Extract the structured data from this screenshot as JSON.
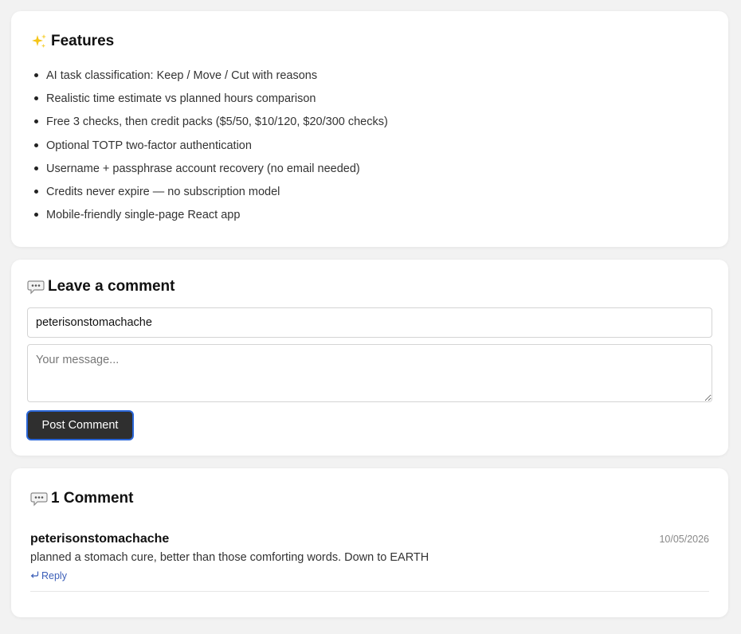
{
  "features": {
    "title": "Features",
    "icon": "sparkles-icon",
    "items": [
      "AI task classification: Keep / Move / Cut with reasons",
      "Realistic time estimate vs planned hours comparison",
      "Free 3 checks, then credit packs ($5/50, $10/120, $20/300 checks)",
      "Optional TOTP two-factor authentication",
      "Username + passphrase account recovery (no email needed)",
      "Credits never expire — no subscription model",
      "Mobile-friendly single-page React app"
    ]
  },
  "comment_form": {
    "title": "Leave a comment",
    "icon": "speech-bubble-icon",
    "name_value": "peterisonstomachache",
    "message_placeholder": "Your message...",
    "submit_label": "Post Comment",
    "button_color": "#2f2f2f",
    "focus_ring_color": "#2a66d8"
  },
  "comments": {
    "title": "1 Comment",
    "icon": "speech-bubble-icon",
    "items": [
      {
        "author": "peterisonstomachache",
        "date": "10/05/2026",
        "body": "planned a stomach cure, better than those comforting words. Down to EARTH",
        "reply_label": "Reply",
        "reply_icon": "reply-arrow-icon"
      }
    ],
    "link_color": "#3c5fb8"
  }
}
